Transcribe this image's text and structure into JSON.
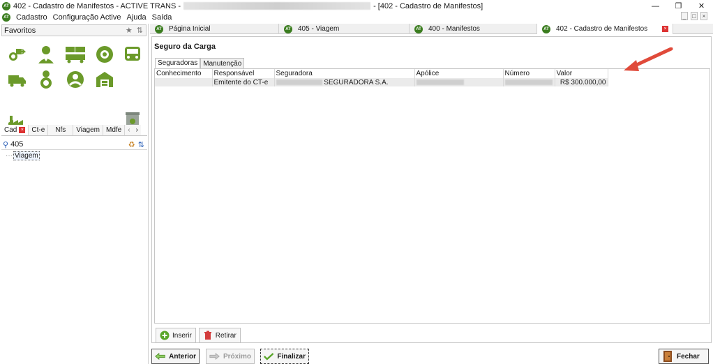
{
  "window": {
    "title_prefix": "402 - Cadastro de Manifestos - ACTIVE TRANS -",
    "title_suffix": "- [402 - Cadastro de Manifestos]",
    "logo": "AT"
  },
  "menu": {
    "items": [
      "Cadastro",
      "Configuração Active",
      "Ajuda",
      "Saída"
    ]
  },
  "favorites": {
    "label": "Favoritos"
  },
  "left_tabs": [
    "Cad",
    "Ct-e",
    "Nfs",
    "Viagem",
    "Mdfe"
  ],
  "search": {
    "value": "405"
  },
  "tree": {
    "item": "Viagem"
  },
  "doc_tabs": [
    {
      "label": "Página Inicial"
    },
    {
      "label": "405 - Viagem"
    },
    {
      "label": "400 - Manifestos"
    },
    {
      "label": "402 - Cadastro de Manifestos"
    }
  ],
  "section": {
    "title": "Seguro da Carga"
  },
  "inner_tabs": [
    "Seguradoras",
    "Manutenção"
  ],
  "grid": {
    "columns": [
      "Conhecimento",
      "Responsável",
      "Seguradora",
      "Apólice",
      "Número",
      "Valor"
    ],
    "rows": [
      {
        "conhecimento": "",
        "responsavel": "Emitente do CT-e",
        "seguradora": "SEGURADORA S.A.",
        "apolice": "",
        "numero": "",
        "valor": "R$ 300.000,00"
      }
    ]
  },
  "grid_buttons": {
    "insert": "Inserir",
    "remove": "Retirar"
  },
  "bottom_buttons": {
    "previous": "Anterior",
    "next": "Próximo",
    "finish": "Finalizar",
    "close": "Fechar"
  },
  "colors": {
    "accent_green": "#3b7d1f",
    "danger_red": "#d33b3b",
    "arrow_red": "#e04a3a"
  }
}
